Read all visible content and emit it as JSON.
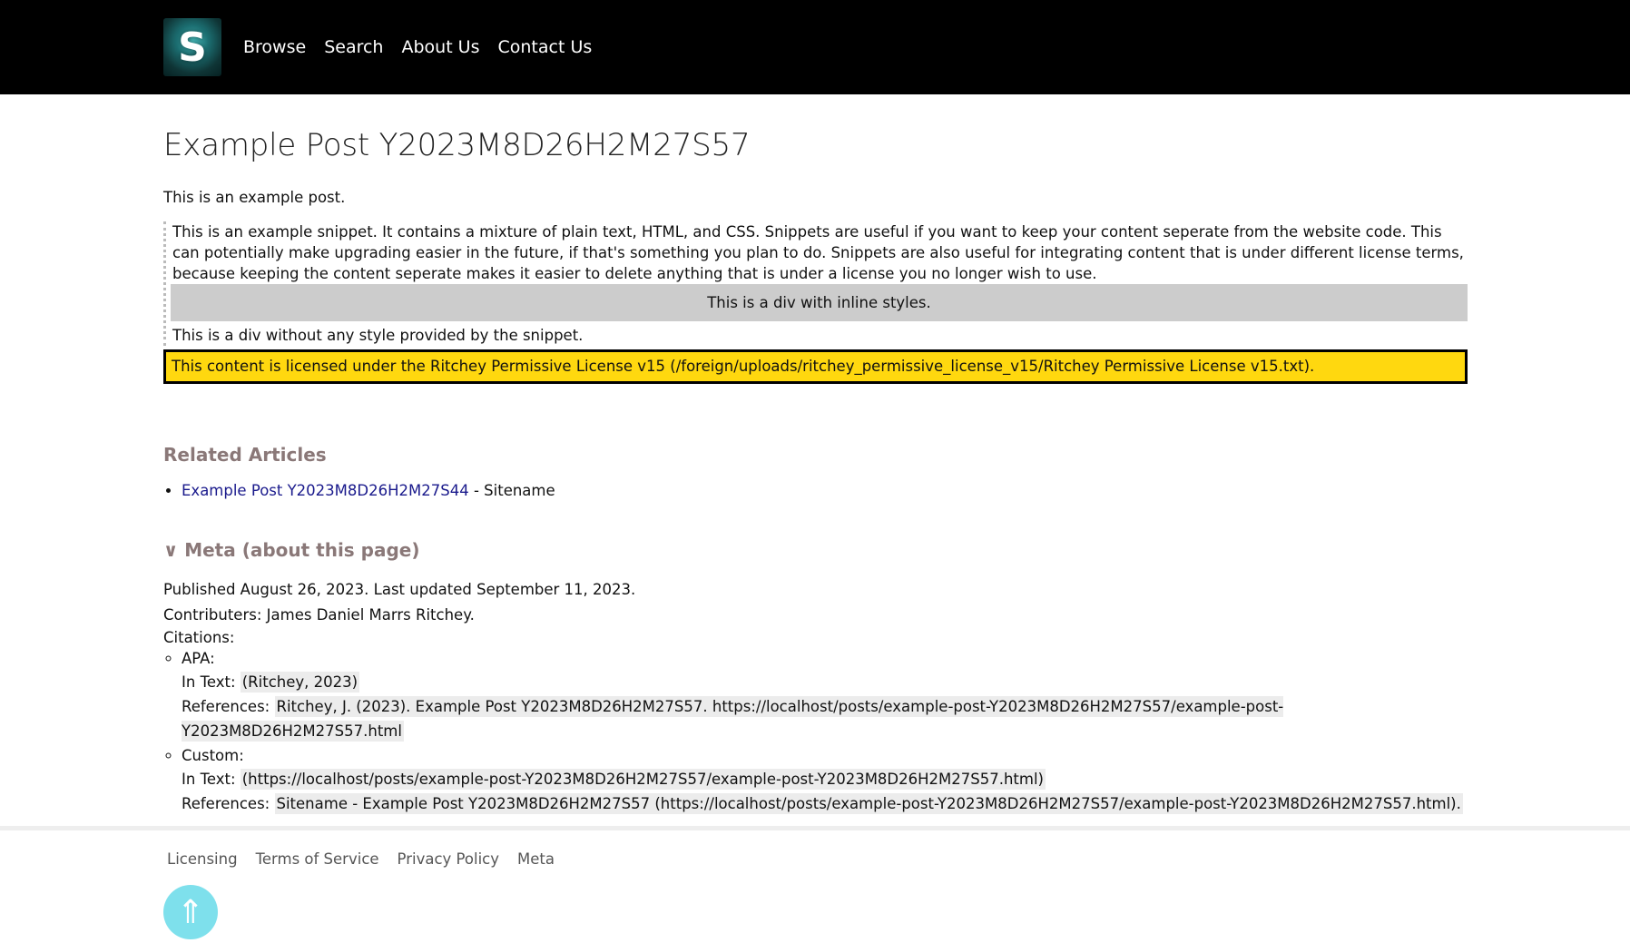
{
  "header": {
    "logo_letter": "S",
    "nav": [
      "Browse",
      "Search",
      "About Us",
      "Contact Us"
    ]
  },
  "post": {
    "title": "Example Post Y2023M8D26H2M27S57",
    "intro": "This is an example post.",
    "snippet_text": "This is an example snippet. It contains a mixture of plain text, HTML, and CSS. Snippets are useful if you want to keep your content seperate from the website code. This can potentially make upgrading easier in the future, if that's something you plan to do. Snippets are also useful for integrating content that is under different license terms, because keeping the content seperate makes it easier to delete anything that is under a license you no longer wish to use.",
    "inline_styled_div": "This is a div with inline styles.",
    "plain_div": "This is a div without any style provided by the snippet.",
    "license_notice": "This content is licensed under the Ritchey Permissive License v15 (/foreign/uploads/ritchey_permissive_license_v15/Ritchey Permissive License v15.txt)."
  },
  "related": {
    "heading": "Related Articles",
    "items": [
      {
        "link": "Example Post Y2023M8D26H2M27S44",
        "suffix": " - Sitename"
      }
    ]
  },
  "meta": {
    "heading": "∨ Meta (about this page)",
    "published": "Published August 26, 2023. Last updated September 11, 2023.",
    "contributors": "Contributers: James Daniel Marrs Ritchey.",
    "citations_label": "Citations:",
    "citations": [
      {
        "style": "APA:",
        "in_text_label": "In Text:",
        "in_text": "(Ritchey, 2023)",
        "references_label": "References:",
        "references": "Ritchey, J. (2023). Example Post Y2023M8D26H2M27S57. https://localhost/posts/example-post-Y2023M8D26H2M27S57/example-post-Y2023M8D26H2M27S57.html"
      },
      {
        "style": "Custom:",
        "in_text_label": "In Text:",
        "in_text": "(https://localhost/posts/example-post-Y2023M8D26H2M27S57/example-post-Y2023M8D26H2M27S57.html)",
        "references_label": "References:",
        "references": "Sitename - Example Post Y2023M8D26H2M27S57 (https://localhost/posts/example-post-Y2023M8D26H2M27S57/example-post-Y2023M8D26H2M27S57.html)."
      }
    ]
  },
  "footer": {
    "links": [
      "Licensing",
      "Terms of Service",
      "Privacy Policy",
      "Meta"
    ],
    "top_button": "⇑"
  },
  "colors": {
    "header_bg": "#000000",
    "license_bg": "#ffd80f",
    "heading_color": "#8a7878",
    "link_color": "#1a1a8c",
    "top_button_bg": "#7ee0ec"
  }
}
